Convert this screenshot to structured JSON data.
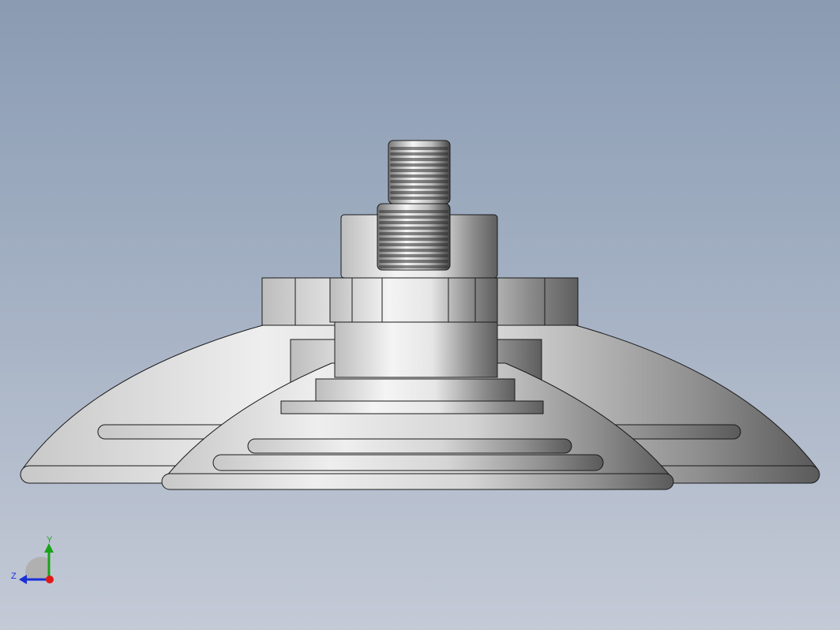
{
  "viewport": {
    "background_top": "#8a9bb2",
    "background_bottom": "#c4cad6"
  },
  "model": {
    "part_color": "#d9d9d9",
    "edge_color": "#1a1a1a"
  },
  "triad": {
    "y_label": "Y",
    "z_label": "Z",
    "y_color": "#1aa31a",
    "z_color": "#1a2fd6",
    "x_color": "#e01818"
  }
}
